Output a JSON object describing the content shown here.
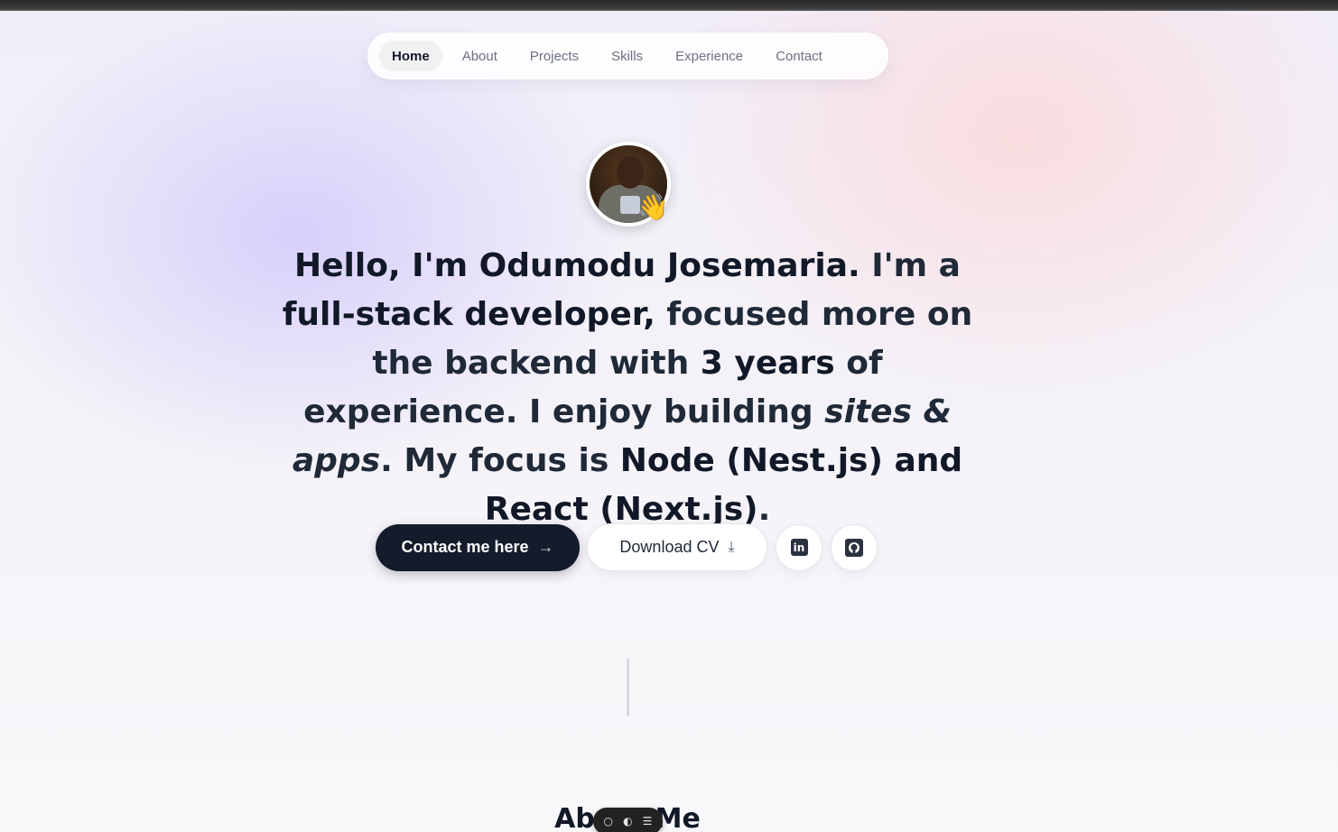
{
  "nav": {
    "items": [
      {
        "label": "Home",
        "active": true
      },
      {
        "label": "About"
      },
      {
        "label": "Projects"
      },
      {
        "label": "Skills"
      },
      {
        "label": "Experience"
      },
      {
        "label": "Contact"
      }
    ]
  },
  "hero": {
    "wave_emoji": "👋",
    "headline": {
      "p1": "Hello, I'm Odumodu Josemaria.",
      "p2": " I'm a ",
      "p3": "full-stack developer,",
      "p4": " focused more on the backend with ",
      "p5": "3 years",
      "p6": " of experience. I enjoy building ",
      "p7": "sites & apps",
      "p8": ". My focus is ",
      "p9": "Node (Nest.js) and React (Next.js)",
      "p10": "."
    },
    "contact_button": "Contact me here",
    "contact_icon": "arrow-right-icon",
    "download_button": "Download CV",
    "download_icon": "download-icon",
    "linkedin_icon": "linkedin-icon",
    "github_icon": "github-icon"
  },
  "about": {
    "title": "About Me"
  },
  "toolbar": {
    "icons": [
      "chat-icon",
      "toggle-icon",
      "menu-icon"
    ]
  }
}
